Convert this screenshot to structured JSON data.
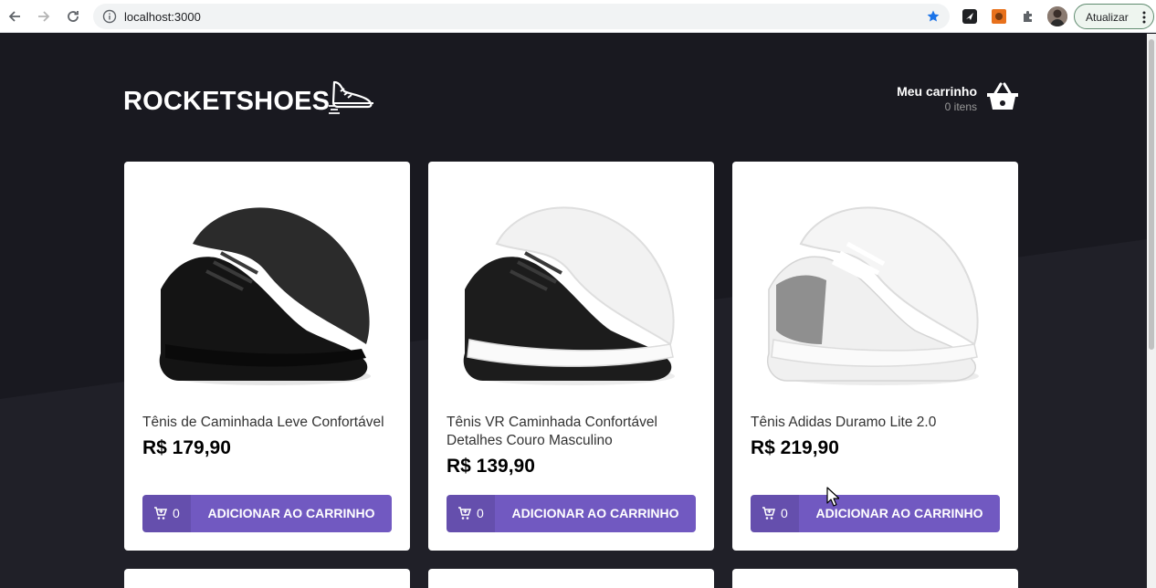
{
  "browser": {
    "url": "localhost:3000",
    "update_label": "Atualizar"
  },
  "header": {
    "logo_text": "ROCKETSHOES",
    "cart_title": "Meu carrinho",
    "cart_count": "0 itens"
  },
  "products": [
    {
      "name": "Tênis de Caminhada Leve Confortável",
      "price": "R$ 179,90",
      "qty": "0",
      "button_label": "ADICIONAR AO CARRINHO",
      "image": "black-sneaker"
    },
    {
      "name": "Tênis VR Caminhada Confortável Detalhes Couro Masculino",
      "price": "R$ 139,90",
      "qty": "0",
      "button_label": "ADICIONAR AO CARRINHO",
      "image": "black-white-sneaker"
    },
    {
      "name": "Tênis Adidas Duramo Lite 2.0",
      "price": "R$ 219,90",
      "qty": "0",
      "button_label": "ADICIONAR AO CARRINHO",
      "image": "white-grey-sneaker"
    }
  ],
  "colors": {
    "background": "#191920",
    "accent": "#7159c1",
    "card": "#ffffff"
  }
}
